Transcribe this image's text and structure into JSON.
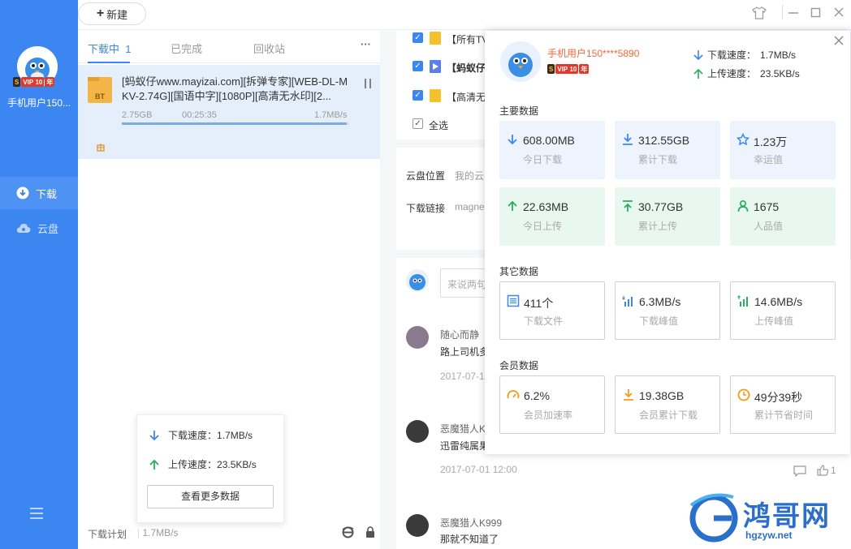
{
  "sidebar": {
    "username": "手机用户150...",
    "vip": {
      "lightning": "S",
      "vip": "VIP",
      "level": "10",
      "year": "年"
    },
    "nav": [
      {
        "label": "下载"
      },
      {
        "label": "云盘"
      }
    ],
    "menu_icon": "hamburger-icon"
  },
  "topbar": {
    "new_label": "新建",
    "plus": "+"
  },
  "tabs": {
    "downloading": "下载中",
    "downloading_count": "1",
    "completed": "已完成",
    "recycle": "回收站",
    "more": "···"
  },
  "task": {
    "title": "[蚂蚁仔www.mayizai.com][拆弹专家][WEB-DL-MKV-2.74G][国语中字][1080P][高清无水印][2...",
    "file_type": "BT",
    "downloaded": "2.75GB",
    "remaining_time": "00:25:35",
    "speed": "1.7MB/s",
    "progress_fraction": 0.99,
    "seed_icon": "peer-icon"
  },
  "speed_popup": {
    "download_label": "下载速度：",
    "download_value": "1.7MB/s",
    "upload_label": "上传速度：",
    "upload_value": "23.5KB/s",
    "more_button": "查看更多数据"
  },
  "bottom": {
    "plan": "下载计划",
    "speed": "1.7MB/s"
  },
  "files": [
    {
      "label": "【所有TV"
    },
    {
      "label": "【蚂蚁仔"
    },
    {
      "label": "【高清无"
    },
    {
      "label": "全选"
    }
  ],
  "info": {
    "location_label": "云盘位置",
    "location_value": "我的云",
    "link_label": "下载链接",
    "link_value": "magne"
  },
  "comments": {
    "input_placeholder": "来说两句",
    "items": [
      {
        "name": "随心而静",
        "text": "路上司机多",
        "time": "2017-07-1"
      },
      {
        "name": "恶魔猎人K",
        "text": "迅雷纯属果",
        "time": "2017-07-01 12:00"
      },
      {
        "name": "恶魔猎人K999",
        "text": "那就不知道了",
        "time": ""
      }
    ],
    "like_count": "1"
  },
  "stats": {
    "username": "手机用户150****5890",
    "download_speed_label": "下载速度：",
    "download_speed": "1.7MB/s",
    "upload_speed_label": "上传速度：",
    "upload_speed": "23.5KB/s",
    "main_header": "主要数据",
    "other_header": "其它数据",
    "member_header": "会员数据",
    "main": [
      {
        "value": "608.00MB",
        "label": "今日下载"
      },
      {
        "value": "312.55GB",
        "label": "累计下载"
      },
      {
        "value": "1.23万",
        "label": "幸运值"
      },
      {
        "value": "22.63MB",
        "label": "今日上传"
      },
      {
        "value": "30.77GB",
        "label": "累计上传"
      },
      {
        "value": "1675",
        "label": "人品值"
      }
    ],
    "other": [
      {
        "value": "411个",
        "label": "下载文件"
      },
      {
        "value": "6.3MB/s",
        "label": "下载峰值"
      },
      {
        "value": "14.6MB/s",
        "label": "上传峰值"
      }
    ],
    "member": [
      {
        "value": "6.2%",
        "label": "会员加速率"
      },
      {
        "value": "19.38GB",
        "label": "会员累计下载"
      },
      {
        "value": "49分39秒",
        "label": "累计节省时间"
      }
    ]
  },
  "watermark": {
    "text": "鸿哥网",
    "url": "hgzyw.net"
  },
  "colors": {
    "accent": "#3b86f0",
    "green": "#27ae60",
    "orange": "#f39c12"
  }
}
